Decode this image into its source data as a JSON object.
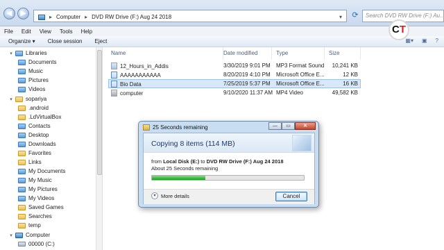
{
  "address": {
    "crumbs": [
      "Computer",
      "DVD RW Drive (F:) Aug 24 2018"
    ],
    "search_placeholder": "Search DVD RW Drive (F:) Au..."
  },
  "menu": [
    "File",
    "Edit",
    "View",
    "Tools",
    "Help"
  ],
  "toolbar": {
    "organize": "Organize ▾",
    "close_session": "Close session",
    "eject": "Eject"
  },
  "logo": {
    "c": "C",
    "t": "T"
  },
  "sidebar": {
    "items": [
      {
        "label": "Libraries",
        "icon": "special-folder-icon"
      },
      {
        "label": "Documents",
        "icon": "special-folder-icon"
      },
      {
        "label": "Music",
        "icon": "special-folder-icon"
      },
      {
        "label": "Pictures",
        "icon": "special-folder-icon"
      },
      {
        "label": "Videos",
        "icon": "special-folder-icon"
      },
      {
        "label": "sopariya",
        "icon": "folder-icon"
      },
      {
        "label": ".android",
        "icon": "folder-icon"
      },
      {
        "label": ".LdVirtualBox",
        "icon": "folder-icon"
      },
      {
        "label": "Contacts",
        "icon": "special-folder-icon"
      },
      {
        "label": "Desktop",
        "icon": "special-folder-icon"
      },
      {
        "label": "Downloads",
        "icon": "special-folder-icon"
      },
      {
        "label": "Favorites",
        "icon": "folder-icon"
      },
      {
        "label": "Links",
        "icon": "folder-icon"
      },
      {
        "label": "My Documents",
        "icon": "special-folder-icon"
      },
      {
        "label": "My Music",
        "icon": "special-folder-icon"
      },
      {
        "label": "My Pictures",
        "icon": "special-folder-icon"
      },
      {
        "label": "My Videos",
        "icon": "special-folder-icon"
      },
      {
        "label": "Saved Games",
        "icon": "folder-icon"
      },
      {
        "label": "Searches",
        "icon": "folder-icon"
      },
      {
        "label": "temp",
        "icon": "folder-icon"
      },
      {
        "label": "Computer",
        "icon": "computer-icon"
      },
      {
        "label": "00000 (C:)",
        "icon": "drive-icon"
      }
    ]
  },
  "columns": {
    "name": "Name",
    "date": "Date modified",
    "type": "Type",
    "size": "Size"
  },
  "files": [
    {
      "name": "12_Hours_in_Addis",
      "date": "3/30/2019 9:01 PM",
      "type": "MP3 Format Sound",
      "size": "10,241 KB",
      "icon": "audio-file-icon"
    },
    {
      "name": "AAAAAAAAAAA",
      "date": "8/20/2019 4:10 PM",
      "type": "Microsoft Office E...",
      "size": "12 KB",
      "icon": "document-file-icon"
    },
    {
      "name": "Bio Data",
      "date": "7/25/2019 5:37 PM",
      "type": "Microsoft Office E...",
      "size": "16 KB",
      "icon": "document-file-icon"
    },
    {
      "name": "computer",
      "date": "9/10/2020 11:37 AM",
      "type": "MP4 Video",
      "size": "49,582 KB",
      "icon": "video-file-icon"
    }
  ],
  "dialog": {
    "title": "25 Seconds remaining",
    "heading": "Copying 8 items (114 MB)",
    "from_prefix": "from ",
    "from": "Local Disk (E:)",
    "to_prefix": " to ",
    "to": "DVD RW Drive (F:) Aug 24 2018",
    "remaining": "About 25 Seconds remaining",
    "progress_fraction": 0.35,
    "more_details": "More details",
    "cancel": "Cancel",
    "btn_min": "—",
    "btn_max": "▭",
    "btn_close": "✕"
  }
}
